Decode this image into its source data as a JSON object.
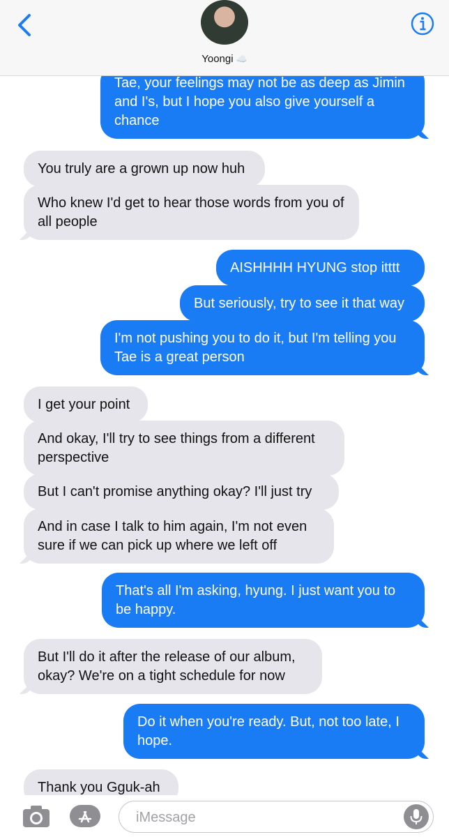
{
  "header": {
    "contact_name": "Yoongi",
    "contact_emoji": "☁️"
  },
  "messages": [
    {
      "side": "out",
      "text": "Tae, your feelings may not be as deep as Jimin and I's, but I hope you also give yourself a chance"
    },
    {
      "side": "in",
      "text": "You truly are a grown up now huh"
    },
    {
      "side": "in",
      "text": "Who knew I'd get to hear those words from you of all people"
    },
    {
      "side": "out",
      "text": "AISHHHH HYUNG stop itttt"
    },
    {
      "side": "out",
      "text": "But seriously, try to see it that way"
    },
    {
      "side": "out",
      "text": "I'm not pushing you to do it, but I'm telling you Tae is a great person"
    },
    {
      "side": "in",
      "text": "I get your point"
    },
    {
      "side": "in",
      "text": "And okay, I'll try to see things from a different perspective"
    },
    {
      "side": "in",
      "text": "But I can't promise anything okay? I'll just try"
    },
    {
      "side": "in",
      "text": "And in case I talk to him again, I'm not even sure if we can pick up where we left off"
    },
    {
      "side": "out",
      "text": "That's all I'm asking, hyung. I just want you to be happy."
    },
    {
      "side": "in",
      "text": "But I'll do it after the release of our album, okay? We're on a tight schedule for now"
    },
    {
      "side": "out",
      "text": "Do it when you're ready. But, not too late, I hope."
    },
    {
      "side": "in",
      "text": "Thank you Gguk-ah"
    }
  ],
  "composer": {
    "placeholder": "iMessage"
  },
  "colors": {
    "accent": "#1a7cf5",
    "incoming_bubble": "#e6e5eb",
    "outgoing_bubble": "#1a7cf5"
  },
  "icons": {
    "back": "chevron-left-icon",
    "info": "info-icon",
    "camera": "camera-icon",
    "apps": "app-store-icon",
    "mic": "microphone-icon"
  }
}
